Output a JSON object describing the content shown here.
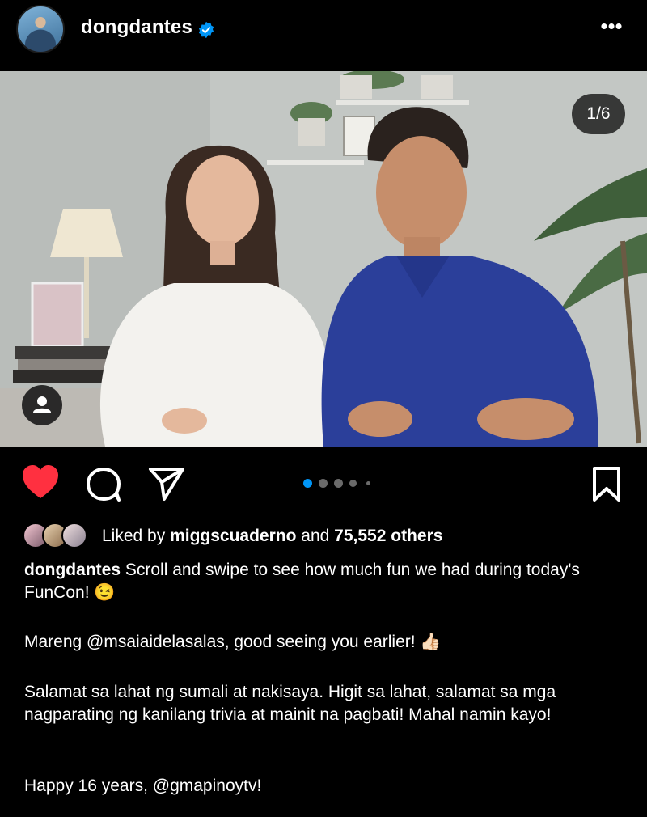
{
  "post": {
    "username": "dongdantes",
    "more_icon": "more-horizontal-icon",
    "verified_icon": "verified-badge-icon",
    "image_counter": "1/6",
    "carousel": {
      "current": 1,
      "total": 6,
      "visible_dots": 5
    }
  },
  "actions": {
    "like_icon": "heart-filled-icon",
    "comment_icon": "comment-icon",
    "share_icon": "send-icon",
    "save_icon": "bookmark-icon"
  },
  "likes": {
    "prefix": "Liked by",
    "user": "miggscuaderno",
    "connector": "and",
    "others": "75,552 others"
  },
  "caption": {
    "username": "dongdantes",
    "line1": "Scroll and swipe to see how much fun we had during today's FunCon! 😉",
    "line2": "Mareng @msaiaidelasalas, good seeing you earlier! 👍🏻",
    "line3": "Salamat sa lahat ng sumali at nakisaya. Higit sa lahat, salamat sa mga nagparating ng kanilang trivia at mainit na pagbati! Mahal namin kayo!",
    "line4": "Happy 16 years, @gmapinoytv!"
  },
  "colors": {
    "background": "#000000",
    "heart": "#ff3040",
    "verified": "#0095f6",
    "active_dot": "#0095f6"
  }
}
